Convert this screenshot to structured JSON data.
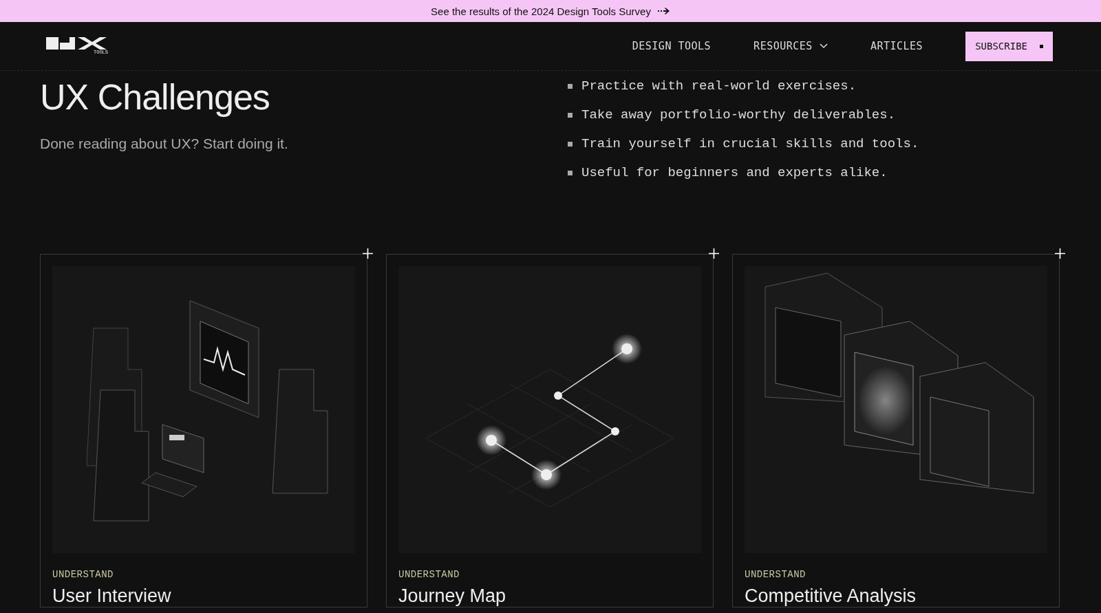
{
  "banner": {
    "text": "See the results of the 2024 Design Tools Survey"
  },
  "nav": {
    "logo_caption": "TOOLS",
    "links": [
      {
        "label": "DESIGN TOOLS",
        "dropdown": false
      },
      {
        "label": "RESOURCES",
        "dropdown": true
      },
      {
        "label": "ARTICLES",
        "dropdown": false
      }
    ],
    "subscribe": "SUBSCRIBE"
  },
  "hero": {
    "title": "UX Challenges",
    "subtitle": "Done reading about UX? Start doing it.",
    "bullets": [
      "Practice with real-world exercises.",
      "Take away portfolio-worthy deliverables.",
      "Train yourself in crucial skills and tools.",
      "Useful for beginners and experts alike."
    ]
  },
  "cards": [
    {
      "category": "UNDERSTAND",
      "title": "User Interview"
    },
    {
      "category": "UNDERSTAND",
      "title": "Journey Map"
    },
    {
      "category": "UNDERSTAND",
      "title": "Competitive Analysis"
    }
  ]
}
